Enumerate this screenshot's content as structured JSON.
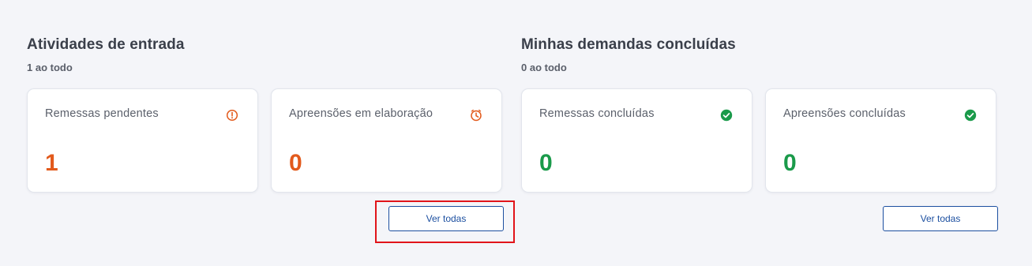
{
  "incoming": {
    "title": "Atividades de entrada",
    "subtitle": "1 ao todo",
    "cards": [
      {
        "label": "Remessas pendentes",
        "value": "1",
        "icon": "alert-circle-icon",
        "color": "#e25a1c"
      },
      {
        "label": "Apreensões em elaboração",
        "value": "0",
        "icon": "clock-icon",
        "color": "#e25a1c"
      }
    ],
    "button_label": "Ver todas"
  },
  "completed": {
    "title": "Minhas demandas concluídas",
    "subtitle": "0 ao todo",
    "cards": [
      {
        "label": "Remessas concluídas",
        "value": "0",
        "icon": "check-circle-icon",
        "color": "#1a9a4a"
      },
      {
        "label": "Apreensões concluídas",
        "value": "0",
        "icon": "check-circle-icon",
        "color": "#1a9a4a"
      }
    ],
    "button_label": "Ver todas"
  },
  "colors": {
    "accent_blue": "#1c4fa0",
    "warning_orange": "#e25a1c",
    "success_green": "#1a9a4a",
    "highlight_red": "#e1141a"
  }
}
